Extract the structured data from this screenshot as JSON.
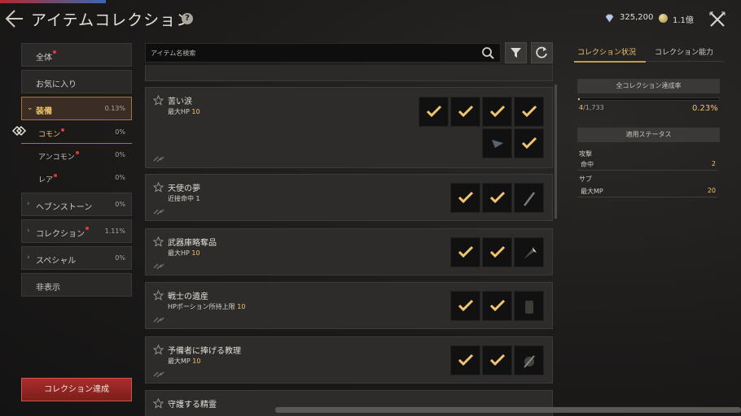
{
  "header": {
    "title": "アイテムコレクション",
    "help": "?",
    "currency1": "325,200",
    "currency2": "1.1億"
  },
  "sidebar": {
    "all": "全体",
    "favorites": "お気に入り",
    "equip": {
      "label": "装備",
      "pct": "0.13%"
    },
    "subs": [
      {
        "label": "コモン",
        "pct": "0%"
      },
      {
        "label": "アンコモン",
        "pct": "0%"
      },
      {
        "label": "レア",
        "pct": "0%"
      }
    ],
    "heavenstone": {
      "label": "ヘブンストーン",
      "pct": "0%"
    },
    "collection": {
      "label": "コレクション",
      "pct": "1.11%"
    },
    "special": {
      "label": "スペシャル",
      "pct": "0%"
    },
    "hidden": "非表示",
    "achieve_button": "コレクション達成"
  },
  "search": {
    "placeholder": "アイテム名検索"
  },
  "items": [
    {
      "name": "苦い涙",
      "stat_label": "最大HP",
      "stat_value": "10"
    },
    {
      "name": "天使の夢",
      "stat_label": "近接命中",
      "stat_value": "1"
    },
    {
      "name": "武器庫略奪品",
      "stat_label": "最大HP",
      "stat_value": "10"
    },
    {
      "name": "戦士の遺産",
      "stat_label": "HPポーション所持上限",
      "stat_value": "10"
    },
    {
      "name": "予備者に捧げる教理",
      "stat_label": "最大MP",
      "stat_value": "10"
    },
    {
      "name": "守護する精霊",
      "stat_label": "",
      "stat_value": ""
    }
  ],
  "right": {
    "tab_status": "コレクション状況",
    "tab_ability": "コレクション能力",
    "achieve_rate_title": "全コレクション達成率",
    "progress_done": "4",
    "progress_total": "/1,733",
    "progress_pct": "0.23%",
    "progress_fraction": 0.0023,
    "applied_title": "適用ステータス",
    "attack_label": "攻撃",
    "accuracy_label": "命中",
    "accuracy_value": "2",
    "sub_label": "サブ",
    "maxmp_label": "最大MP",
    "maxmp_value": "20"
  },
  "colors": {
    "accent": "#f0c56e",
    "achieve_button": "#a82d2b",
    "new_dot": "#e0393a"
  }
}
